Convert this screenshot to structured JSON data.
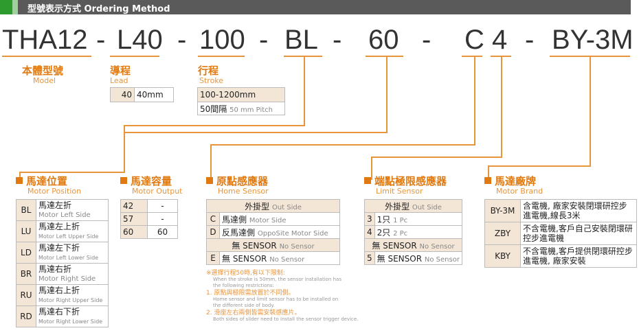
{
  "header": {
    "title": "型號表示方式 Ordering Method"
  },
  "model_code": {
    "segments": [
      "THA12",
      "L40",
      "100",
      "BL",
      "60",
      "C",
      "4",
      "BY-3M"
    ],
    "separator": "-"
  },
  "model": {
    "cn": "本體型號",
    "en": "Model"
  },
  "lead": {
    "cn": "導程",
    "en": "Lead",
    "value": "40",
    "desc": "40mm"
  },
  "stroke": {
    "cn": "行程",
    "en": "Stroke",
    "range": "100-1200mm",
    "pitch_cn": "50間隔",
    "pitch_en": "50 mm Pitch"
  },
  "motor_position": {
    "cn": "馬達位置",
    "en": "Motor Position",
    "rows": [
      {
        "code": "BL",
        "cn": "馬達左折",
        "en": "Motor Left Side"
      },
      {
        "code": "LU",
        "cn": "馬達左上折",
        "en": "Motor Left Upper Side"
      },
      {
        "code": "LD",
        "cn": "馬達左下折",
        "en": "Motor Left Lower Side"
      },
      {
        "code": "BR",
        "cn": "馬達右折",
        "en": "Motor Right Side"
      },
      {
        "code": "RU",
        "cn": "馬達右上折",
        "en": "Motor Right Upper Side"
      },
      {
        "code": "RD",
        "cn": "馬達右下折",
        "en": "Motor Right Lower Side"
      }
    ]
  },
  "motor_output": {
    "cn": "馬達容量",
    "en": "Motor Output",
    "rows": [
      [
        "42",
        "-"
      ],
      [
        "57",
        "-"
      ],
      [
        "60",
        "60"
      ]
    ]
  },
  "home_sensor": {
    "cn": "原點感應器",
    "en": "Home Sensor",
    "header_cn": "外掛型",
    "header_en": "Out Side",
    "rows": [
      {
        "code": "C",
        "cn": "馬達側",
        "en": "Motor Side"
      },
      {
        "code": "D",
        "cn": "反馬達側",
        "en": "OppoSite Motor Side"
      },
      {
        "code": "",
        "cn": "無 SENSOR",
        "en": "No Sensor"
      },
      {
        "code": "E",
        "cn": "無 SENSOR",
        "en": "No Sensor"
      }
    ],
    "notes": [
      {
        "cn": "※選擇行程50時,有以下限制:",
        "en": "When the stroke is 50mm, the sensor installation has the following restrictions:"
      },
      {
        "cn": "1. 原點與極限需放置於不同側。",
        "en": "Home sensor and limit sensor has to be installed on the different side of body."
      },
      {
        "cn": "2. 滑座左右兩側皆需安裝感應片。",
        "en": "Both sides of slider need to install the sensor trigger device."
      }
    ]
  },
  "limit_sensor": {
    "cn": "端點極限感應器",
    "en": "Limit Sensor",
    "header_cn": "外掛型",
    "header_en": "Out Side",
    "rows": [
      {
        "code": "3",
        "cn": "1只",
        "en": "1 Pc"
      },
      {
        "code": "4",
        "cn": "2只",
        "en": "2 Pc"
      },
      {
        "code": "",
        "cn": "無 SENSOR",
        "en": "No Sensor"
      },
      {
        "code": "5",
        "cn": "無 SENSOR",
        "en": "No Sensor"
      }
    ]
  },
  "motor_brand": {
    "cn": "馬達廠牌",
    "en": "Motor Brand",
    "rows": [
      {
        "code": "BY-3M",
        "desc": "含電機, 廠家安裝閉環研控步進電機,線長3米"
      },
      {
        "code": "ZBY",
        "desc": "不含電機,客戶自己安裝閉環研控步進電機"
      },
      {
        "code": "KBY",
        "desc": "不含電機,客戶提供閉環研控步進電機, 廠家安裝"
      }
    ]
  },
  "colors": {
    "accent": "#e07a10",
    "line": "#e8943a",
    "header_bg": "#5a5a5a",
    "header_green": "#2e9b2e"
  }
}
